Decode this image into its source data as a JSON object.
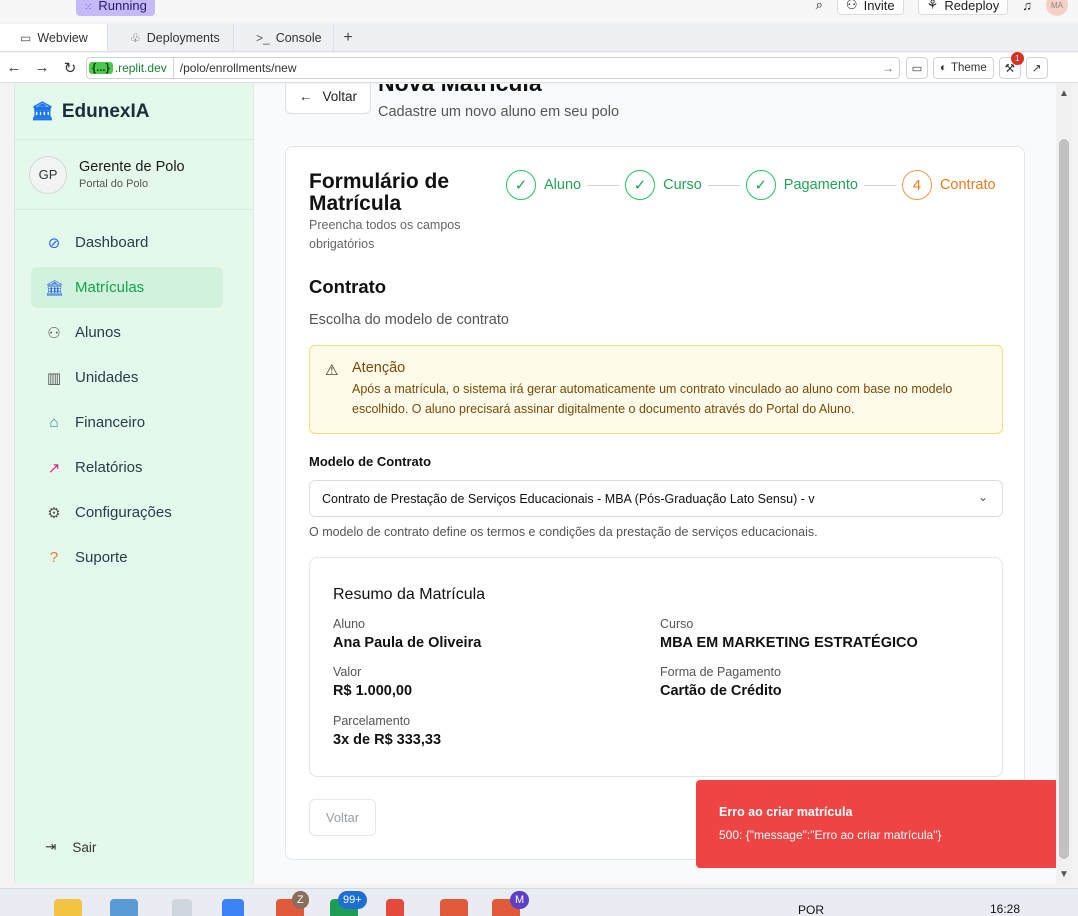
{
  "topbar": {
    "status_label": "Running",
    "invite_label": "Invite",
    "redeploy_label": "Redeploy",
    "avatar_initials": "MA"
  },
  "tabs": [
    {
      "label": "Webview",
      "icon": "monitor-icon"
    },
    {
      "label": "Deployments",
      "icon": "deployments-icon"
    },
    {
      "label": "Console",
      "icon": "terminal-icon"
    }
  ],
  "url": {
    "host_badge": "{...}",
    "host": ".replit.dev",
    "path": "/polo/enrollments/new",
    "theme_label": "Theme",
    "notification_count": "1"
  },
  "sidebar": {
    "brand": "EdunexIA",
    "user": {
      "initials": "GP",
      "name": "Gerente de Polo",
      "role": "Portal do Polo"
    },
    "items": [
      {
        "label": "Dashboard",
        "icon": "dashboard-icon"
      },
      {
        "label": "Matrículas",
        "icon": "school-icon"
      },
      {
        "label": "Alunos",
        "icon": "users-icon"
      },
      {
        "label": "Unidades",
        "icon": "store-icon"
      },
      {
        "label": "Financeiro",
        "icon": "bank-icon"
      },
      {
        "label": "Relatórios",
        "icon": "chart-line-icon"
      },
      {
        "label": "Configurações",
        "icon": "gear-icon"
      },
      {
        "label": "Suporte",
        "icon": "help-circle-icon"
      }
    ],
    "logout_label": "Sair"
  },
  "page": {
    "back_label": "Voltar",
    "title": "Nova Matrícula",
    "subtitle": "Cadastre um novo aluno em seu polo"
  },
  "form": {
    "title": "Formulário de Matrícula",
    "subtitle": "Preencha todos os campos obrigatórios",
    "steps": [
      {
        "label": "Aluno",
        "marker": "✓"
      },
      {
        "label": "Curso",
        "marker": "✓"
      },
      {
        "label": "Pagamento",
        "marker": "✓"
      },
      {
        "label": "Contrato",
        "marker": "4"
      }
    ],
    "section_title": "Contrato",
    "section_subtitle": "Escolha do modelo de contrato",
    "alert": {
      "title": "Atenção",
      "body": "Após a matrícula, o sistema irá gerar automaticamente um contrato vinculado ao aluno com base no modelo escolhido. O aluno precisará assinar digitalmente o documento através do Portal do Aluno."
    },
    "contract_label": "Modelo de Contrato",
    "contract_value": "Contrato de Prestação de Serviços Educacionais - MBA (Pós-Graduação Lato Sensu) - v",
    "contract_help": "O modelo de contrato define os termos e condições da prestação de serviços educacionais.",
    "summary": {
      "title": "Resumo da Matrícula",
      "aluno_label": "Aluno",
      "aluno_value": "Ana Paula de Oliveira",
      "curso_label": "Curso",
      "curso_value": "MBA EM MARKETING ESTRATÉGICO",
      "valor_label": "Valor",
      "valor_value": "R$ 1.000,00",
      "pagamento_label": "Forma de Pagamento",
      "pagamento_value": "Cartão de Crédito",
      "parcelamento_label": "Parcelamento",
      "parcelamento_value": "3x de R$ 333,33"
    },
    "back_button": "Voltar"
  },
  "toast": {
    "title": "Erro ao criar matrícula",
    "message": "500: {\"message\":\"Erro ao criar matrícula\"}"
  },
  "taskbar": {
    "badges": [
      "Z",
      "99+",
      "M"
    ],
    "lang": "POR",
    "clock": "16:28"
  },
  "colors": {
    "accent_green": "#16a34a",
    "step_done": "#22c55e",
    "step_current": "#ea7a1e",
    "error": "#ef4444",
    "sidebar_bg": "#e4f9ec"
  }
}
